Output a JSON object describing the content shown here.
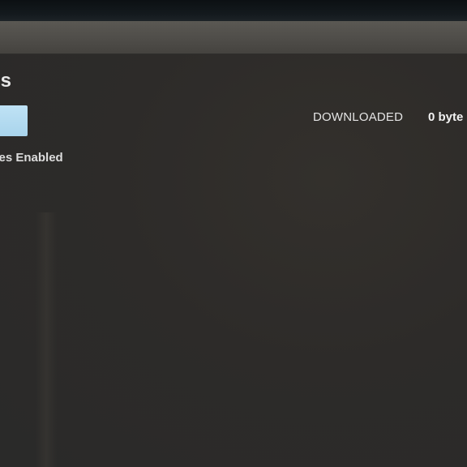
{
  "header": {
    "title": "ns"
  },
  "actions": {
    "primary_button_label": ""
  },
  "status": {
    "text": "ales Enabled"
  },
  "downloads": {
    "label": "DOWNLOADED",
    "value": "0 byte"
  },
  "colors": {
    "background": "#2b2b2a",
    "topbar": "#4e4c48",
    "button": "#a9d4ec",
    "text": "#e4e4e4"
  }
}
